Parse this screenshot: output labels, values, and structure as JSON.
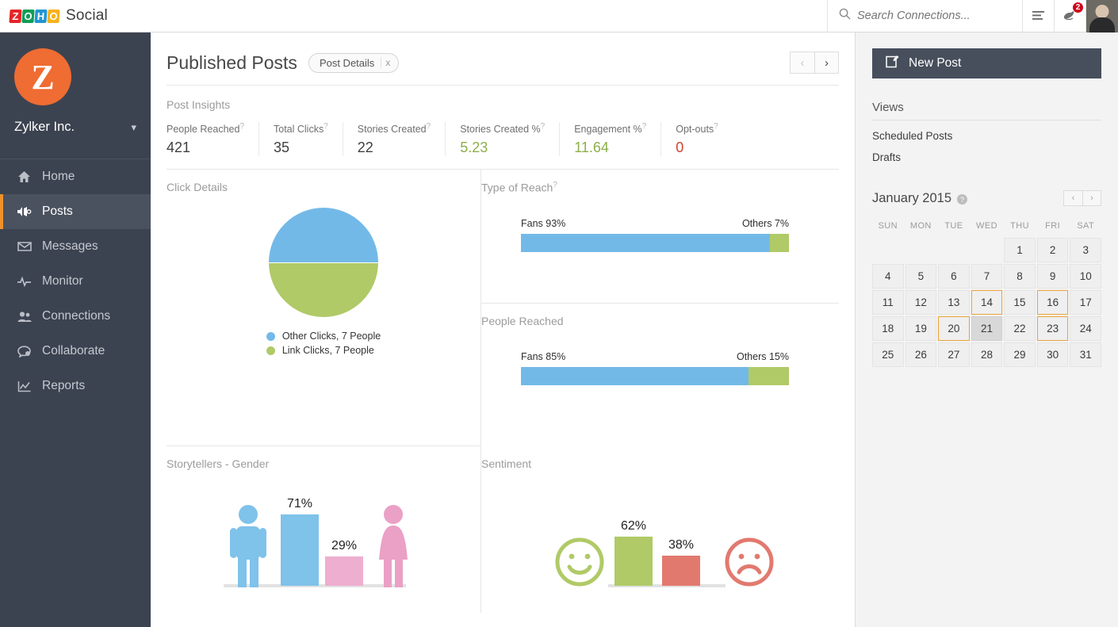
{
  "topbar": {
    "logo_letters": [
      "Z",
      "O",
      "H",
      "O"
    ],
    "brand_name": "Social",
    "search_placeholder": "Search Connections...",
    "search_value": "",
    "notification_count": "2"
  },
  "sidebar": {
    "org_initial": "Z",
    "org_name": "Zylker Inc.",
    "items": [
      {
        "label": "Home",
        "icon": "home-icon",
        "active": false
      },
      {
        "label": "Posts",
        "icon": "megaphone-icon",
        "active": true
      },
      {
        "label": "Messages",
        "icon": "envelope-icon",
        "active": false
      },
      {
        "label": "Monitor",
        "icon": "pulse-icon",
        "active": false
      },
      {
        "label": "Connections",
        "icon": "people-icon",
        "active": false
      },
      {
        "label": "Collaborate",
        "icon": "chat-icon",
        "active": false
      },
      {
        "label": "Reports",
        "icon": "chart-icon",
        "active": false
      }
    ]
  },
  "main": {
    "page_title": "Published Posts",
    "chip_label": "Post Details",
    "chip_close": "x",
    "prev_label": "‹",
    "next_label": "›",
    "insights_title": "Post Insights",
    "insights": [
      {
        "label": "People Reached",
        "value": "421",
        "tone": "dark"
      },
      {
        "label": "Total Clicks",
        "value": "35",
        "tone": "dark"
      },
      {
        "label": "Stories Created",
        "value": "22",
        "tone": "dark"
      },
      {
        "label": "Stories Created %",
        "value": "5.23",
        "tone": "green"
      },
      {
        "label": "Engagement %",
        "value": "11.64",
        "tone": "green"
      },
      {
        "label": "Opt-outs",
        "value": "0",
        "tone": "red"
      }
    ],
    "click_details": {
      "title": "Click Details"
    },
    "type_of_reach": {
      "title": "Type of Reach",
      "has_help": true
    },
    "people_reached": {
      "title": "People Reached",
      "has_help": false
    },
    "storytellers": {
      "title": "Storytellers - Gender"
    },
    "sentiment": {
      "title": "Sentiment"
    }
  },
  "rightpanel": {
    "new_post_label": "New Post",
    "views_title": "Views",
    "views": [
      "Scheduled Posts",
      "Drafts"
    ],
    "calendar": {
      "title": "January 2015",
      "prev": "‹",
      "next": "›",
      "dow": [
        "SUN",
        "MON",
        "TUE",
        "WED",
        "THU",
        "FRI",
        "SAT"
      ],
      "weeks": [
        [
          "",
          "",
          "",
          "",
          "1",
          "2",
          "3"
        ],
        [
          "4",
          "5",
          "6",
          "7",
          "8",
          "9",
          "10"
        ],
        [
          "11",
          "12",
          "13",
          "14",
          "15",
          "16",
          "17"
        ],
        [
          "18",
          "19",
          "20",
          "21",
          "22",
          "23",
          "24"
        ],
        [
          "25",
          "26",
          "27",
          "28",
          "29",
          "30",
          "31"
        ]
      ],
      "marked_days": [
        "14",
        "16",
        "20",
        "23"
      ],
      "today": "21"
    }
  },
  "colors": {
    "blue": "#73b9e8",
    "green": "#b0ca67",
    "pink": "#eeaed0",
    "red": "#e2796f",
    "orange": "#ef6c33",
    "sidebar": "#3c4350",
    "accent_orange": "#f0922b"
  },
  "chart_data": [
    {
      "type": "pie",
      "title": "Click Details",
      "labels": [
        "Other Clicks, 7 People",
        "Link Clicks, 7 People"
      ],
      "values": [
        50,
        50
      ],
      "colors": [
        "#73b9e8",
        "#b0ca67"
      ],
      "legend": "bottom"
    },
    {
      "type": "bar",
      "title": "Type of Reach",
      "orientation": "horizontal-stacked",
      "categories": [
        "Fans",
        "Others"
      ],
      "values": [
        93,
        7
      ],
      "labels": [
        "Fans 93%",
        "Others 7%"
      ],
      "colors": [
        "#73b9e8",
        "#b0ca67"
      ],
      "ylim": [
        0,
        100
      ]
    },
    {
      "type": "bar",
      "title": "People Reached",
      "orientation": "horizontal-stacked",
      "categories": [
        "Fans",
        "Others"
      ],
      "values": [
        85,
        15
      ],
      "labels": [
        "Fans 85%",
        "Others 15%"
      ],
      "colors": [
        "#73b9e8",
        "#b0ca67"
      ],
      "ylim": [
        0,
        100
      ]
    },
    {
      "type": "bar",
      "title": "Storytellers - Gender",
      "categories": [
        "Male",
        "Female"
      ],
      "values": [
        71,
        29
      ],
      "labels": [
        "71%",
        "29%"
      ],
      "colors": [
        "#7fc2ea",
        "#eeaed0"
      ],
      "ylim": [
        0,
        100
      ]
    },
    {
      "type": "bar",
      "title": "Sentiment",
      "categories": [
        "Positive",
        "Negative"
      ],
      "values": [
        62,
        38
      ],
      "labels": [
        "62%",
        "38%"
      ],
      "colors": [
        "#b0ca67",
        "#e2796f"
      ],
      "ylim": [
        0,
        100
      ]
    }
  ]
}
